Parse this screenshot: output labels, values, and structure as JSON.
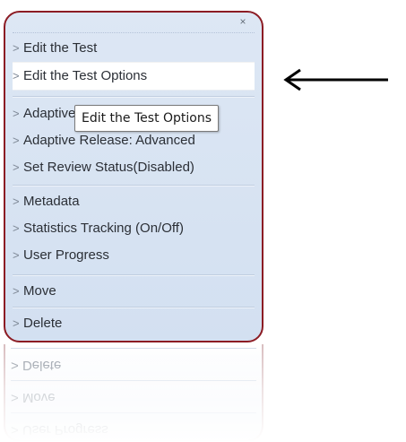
{
  "menu": {
    "close_label": "×",
    "groups": [
      {
        "items": [
          {
            "label": "Edit the Test"
          },
          {
            "label": "Edit the Test Options"
          }
        ]
      },
      {
        "items": [
          {
            "label": "Adaptive Release"
          },
          {
            "label": "Adaptive Release: Advanced"
          },
          {
            "label": "Set Review Status(Disabled)"
          }
        ]
      },
      {
        "items": [
          {
            "label": "Metadata"
          },
          {
            "label": "Statistics Tracking (On/Off)"
          },
          {
            "label": "User Progress"
          }
        ]
      },
      {
        "items": [
          {
            "label": "Move"
          }
        ]
      },
      {
        "items": [
          {
            "label": "Delete"
          }
        ]
      }
    ],
    "highlighted_item": "Edit the Test Options",
    "chevron": ">"
  },
  "tooltip": {
    "text": "Edit the Test Options"
  },
  "colors": {
    "menu_border": "#8c1c24",
    "menu_background": "#d9e4f3",
    "text": "#2b2f36",
    "arrow": "#000000"
  },
  "icons": {
    "close": "close-icon",
    "chevron": "chevron-right-icon",
    "arrow": "arrow-left-icon"
  }
}
